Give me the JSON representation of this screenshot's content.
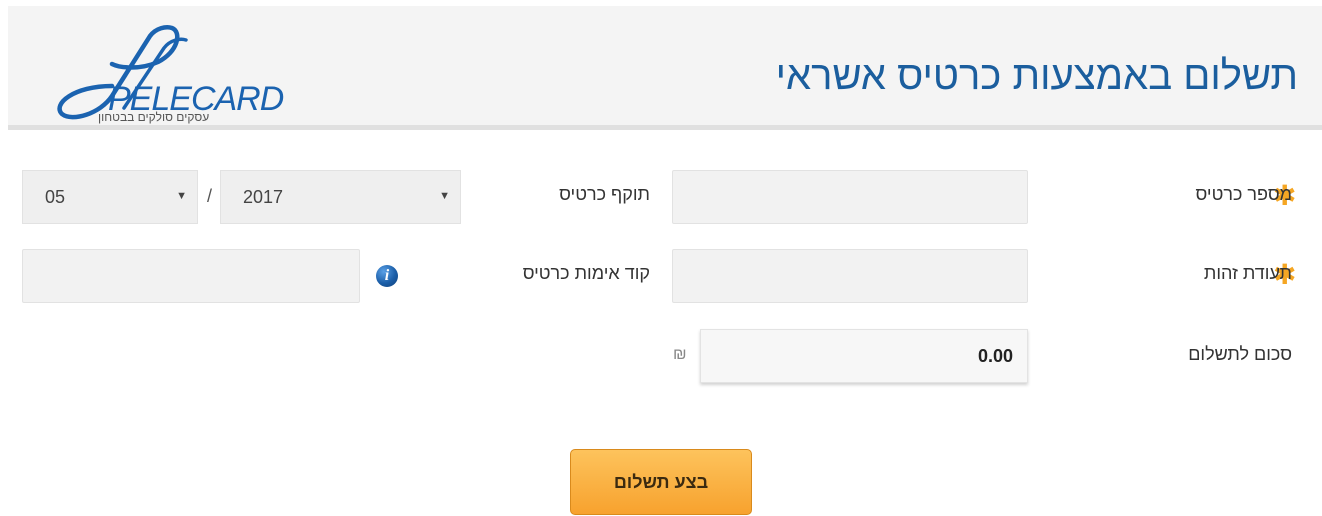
{
  "header": {
    "title": "תשלום באמצעות כרטיס אשראי",
    "logo": {
      "name": "pelecard-logo",
      "wordmark": "PELECARD",
      "tagline": "עסקים סולקים בבטחון"
    }
  },
  "form": {
    "card_number": {
      "label": "מספר כרטיס",
      "required": true,
      "value": ""
    },
    "id_number": {
      "label": "תעודת זהות",
      "required": true,
      "value": ""
    },
    "amount": {
      "label": "סכום לתשלום",
      "value": "0.00",
      "currency_symbol": "₪"
    },
    "expiry": {
      "label": "תוקף כרטיס",
      "year": "2017",
      "month": "05",
      "separator": "/"
    },
    "cvv": {
      "label": "קוד אימות כרטיס",
      "value": "",
      "info_icon": "info-icon"
    }
  },
  "actions": {
    "pay_label": "בצע תשלום"
  },
  "colors": {
    "title": "#1b5e9e",
    "required_star": "#f5a623",
    "button_top": "#fdc35c",
    "button_bottom": "#f7a22e",
    "header_bg": "#f4f4f4"
  }
}
